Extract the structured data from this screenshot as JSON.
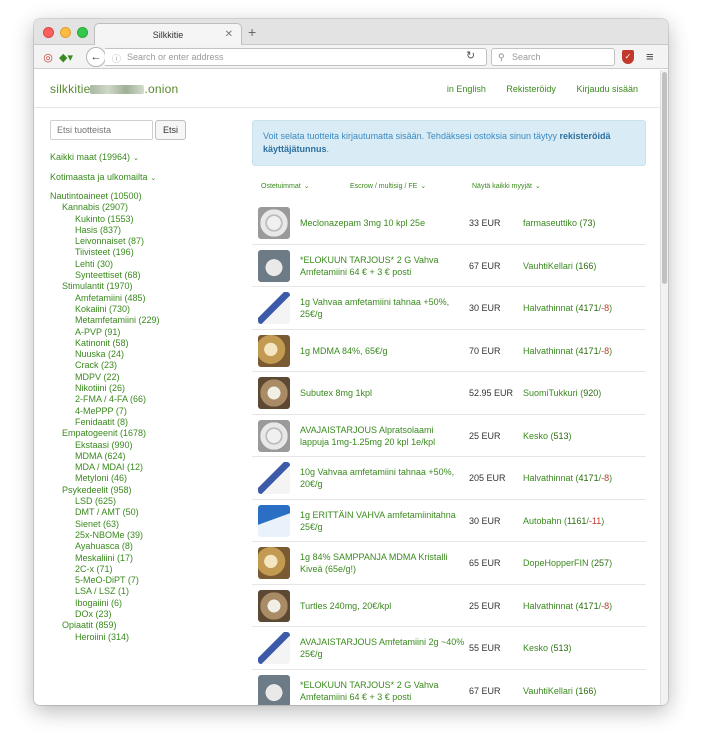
{
  "browser": {
    "tab_title": "Silkkitie",
    "url_placeholder": "Search or enter address",
    "search_placeholder": "Search"
  },
  "site": {
    "logo_prefix": "silkkitie",
    "logo_suffix": ".onion",
    "links": [
      "in English",
      "Rekisteröidy",
      "Kirjaudu sisään"
    ]
  },
  "sidebar": {
    "search_placeholder": "Etsi tuotteista",
    "search_button": "Etsi",
    "filter_country": "Kaikki maat (19964)",
    "filter_origin": "Kotimaasta ja ulkomailta",
    "categories": [
      {
        "label": "Nautintoaineet (10500)",
        "level": 0
      },
      {
        "label": "Kannabis (2907)",
        "level": 1
      },
      {
        "label": "Kukinto (1553)",
        "level": 2
      },
      {
        "label": "Hasis (837)",
        "level": 2
      },
      {
        "label": "Leivonnaiset (87)",
        "level": 2
      },
      {
        "label": "Tiivisteet (196)",
        "level": 2
      },
      {
        "label": "Lehti (30)",
        "level": 2
      },
      {
        "label": "Synteettiset (68)",
        "level": 2
      },
      {
        "label": "Stimulantit (1970)",
        "level": 1
      },
      {
        "label": "Amfetamiini (485)",
        "level": 2
      },
      {
        "label": "Kokaiini (730)",
        "level": 2
      },
      {
        "label": "Metamfetamiini (229)",
        "level": 2
      },
      {
        "label": "A-PVP (91)",
        "level": 2
      },
      {
        "label": "Katinonit (58)",
        "level": 2
      },
      {
        "label": "Nuuska (24)",
        "level": 2
      },
      {
        "label": "Crack (23)",
        "level": 2
      },
      {
        "label": "MDPV (22)",
        "level": 2
      },
      {
        "label": "Nikotiini (26)",
        "level": 2
      },
      {
        "label": "2-FMA / 4-FA (66)",
        "level": 2
      },
      {
        "label": "4-MePPP (7)",
        "level": 2
      },
      {
        "label": "Fenidaatit (8)",
        "level": 2
      },
      {
        "label": "Empatogeenit (1678)",
        "level": 1
      },
      {
        "label": "Ekstaasi (990)",
        "level": 2
      },
      {
        "label": "MDMA (624)",
        "level": 2
      },
      {
        "label": "MDA / MDAI (12)",
        "level": 2
      },
      {
        "label": "Metyloni (46)",
        "level": 2
      },
      {
        "label": "Psykedeelit (958)",
        "level": 1
      },
      {
        "label": "LSD (625)",
        "level": 2
      },
      {
        "label": "DMT / AMT (50)",
        "level": 2
      },
      {
        "label": "Sienet (63)",
        "level": 2
      },
      {
        "label": "25x-NBOMe (39)",
        "level": 2
      },
      {
        "label": "Ayahuasca (8)",
        "level": 2
      },
      {
        "label": "Meskaliini (17)",
        "level": 2
      },
      {
        "label": "2C-x (71)",
        "level": 2
      },
      {
        "label": "5-MeO-DiPT (7)",
        "level": 2
      },
      {
        "label": "LSA / LSZ (1)",
        "level": 2
      },
      {
        "label": "Ibogaiini (6)",
        "level": 2
      },
      {
        "label": "DOx (23)",
        "level": 2
      },
      {
        "label": "Opiaatit (859)",
        "level": 1
      },
      {
        "label": "Heroiini (314)",
        "level": 2
      }
    ]
  },
  "notice": {
    "text": "Voit selata tuotteita kirjautumatta sisään. Tehdäksesi ostoksia sinun täytyy ",
    "bold": "rekisteröidä käyttäjätunnus",
    "end": "."
  },
  "sort": {
    "bestsellers": "Ostetuimmat",
    "escrow": "Escrow / multisig / FE",
    "sellers": "Näytä kaikki myyjät"
  },
  "listings": [
    {
      "title": "Meclonazepam 3mg 10 kpl 25e",
      "price": "33 EUR",
      "seller": "farmaseuttiko",
      "score": "73",
      "neg": "",
      "thumb": "pills-grey"
    },
    {
      "title": "*ELOKUUN TARJOUS* 2 G Vahva Amfetamiini 64 € + 3 € posti",
      "price": "67 EUR",
      "seller": "VauhtiKellari",
      "score": "166",
      "neg": "",
      "thumb": "powder-dark"
    },
    {
      "title": "1g Vahvaa amfetamiini tahnaa +50%, 25€/g",
      "price": "30 EUR",
      "seller": "Halvathinnat",
      "score": "4171",
      "neg": "-8",
      "thumb": "bag-white"
    },
    {
      "title": "1g MDMA 84%, 65€/g",
      "price": "70 EUR",
      "seller": "Halvathinnat",
      "score": "4171",
      "neg": "-8",
      "thumb": "crystal-brown"
    },
    {
      "title": "Subutex 8mg 1kpl",
      "price": "52.95 EUR",
      "seller": "SuomiTukkuri",
      "score": "920",
      "neg": "",
      "thumb": "pills-brown"
    },
    {
      "title": "AVAJAISTARJOUS Alpratsolaami lappuja 1mg-1.25mg 20 kpl 1e/kpl",
      "price": "25 EUR",
      "seller": "Kesko",
      "score": "513",
      "neg": "",
      "thumb": "pills-grey"
    },
    {
      "title": "10g Vahvaa amfetamiini tahnaa +50%, 20€/g",
      "price": "205 EUR",
      "seller": "Halvathinnat",
      "score": "4171",
      "neg": "-8",
      "thumb": "bag-white"
    },
    {
      "title": "1g ERITTÄIN VAHVA amfetamiinitahna 25€/g",
      "price": "30 EUR",
      "seller": "Autobahn",
      "score": "1161",
      "neg": "-11",
      "thumb": "blue-pack"
    },
    {
      "title": "1g 84% SAMPPANJA MDMA Kristalli Kiveä (65e/g!)",
      "price": "65 EUR",
      "seller": "DopeHopperFIN",
      "score": "257",
      "neg": "",
      "thumb": "crystal-brown"
    },
    {
      "title": "Turtles 240mg, 20€/kpl",
      "price": "25 EUR",
      "seller": "Halvathinnat",
      "score": "4171",
      "neg": "-8",
      "thumb": "pills-brown"
    },
    {
      "title": "AVAJAISTARJOUS Amfetamiini 2g ~40% 25€/g",
      "price": "55 EUR",
      "seller": "Kesko",
      "score": "513",
      "neg": "",
      "thumb": "bag-white"
    },
    {
      "title": "*ELOKUUN TARJOUS* 2 G Vahva Amfetamiini 64 € + 3 € posti",
      "price": "67 EUR",
      "seller": "VauhtiKellari",
      "score": "166",
      "neg": "",
      "thumb": "powder-dark"
    }
  ],
  "colors": {
    "link": "#3a8a1e",
    "negative": "#c0392b",
    "notice_bg": "#d9ecf6",
    "notice_text": "#3b8ac1"
  }
}
